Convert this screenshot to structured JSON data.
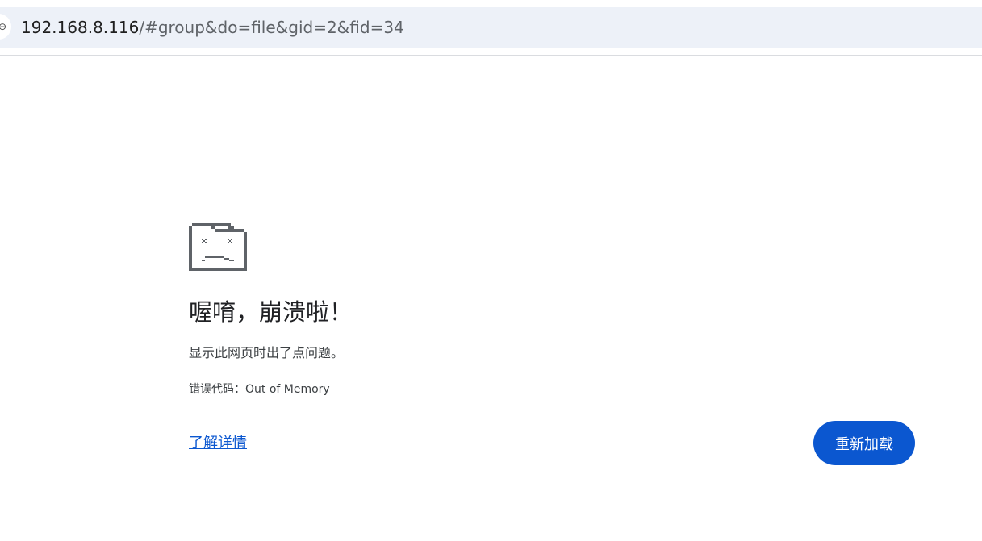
{
  "address_bar": {
    "url_host": "192.168.8.116",
    "url_path": "/#group&do=file&gid=2&fid=34"
  },
  "error_page": {
    "icon": "sad-folder-icon",
    "title": "喔唷，崩溃啦！",
    "message": "显示此网页时出了点问题。",
    "error_code": "错误代码：Out of Memory",
    "learn_more_label": "了解详情",
    "reload_label": "重新加载"
  },
  "colors": {
    "accent": "#0b57d0",
    "omnibox_bg": "#edf1f8",
    "icon": "#5f6368"
  }
}
